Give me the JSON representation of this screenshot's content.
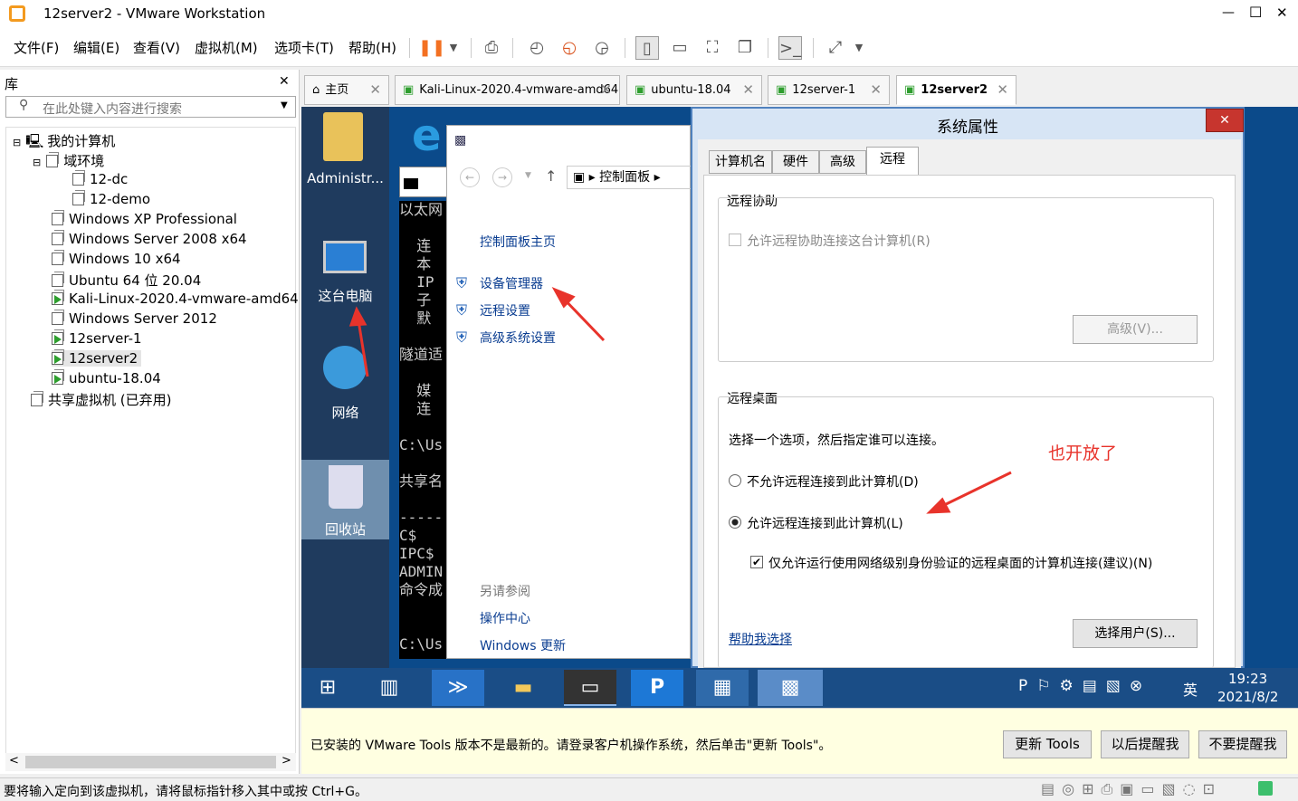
{
  "window": {
    "title": "12server2 - VMware Workstation",
    "minimize": "—",
    "maximize": "☐",
    "close": "✕"
  },
  "menu": [
    "文件(F)",
    "编辑(E)",
    "查看(V)",
    "虚拟机(M)",
    "选项卡(T)",
    "帮助(H)"
  ],
  "library": {
    "title": "库",
    "close": "✕",
    "search_placeholder": "在此处键入内容进行搜索",
    "root": "我的计算机",
    "domain_group": "域环境",
    "domain_items": [
      "12-dc",
      "12-demo"
    ],
    "vms": [
      "Windows XP Professional",
      "Windows Server 2008 x64",
      "Windows 10 x64",
      "Ubuntu 64 位 20.04",
      "Kali-Linux-2020.4-vmware-amd64",
      "Windows Server 2012",
      "12server-1",
      "12server2",
      "ubuntu-18.04"
    ],
    "shared": "共享虚拟机 (已弃用)"
  },
  "tabs": [
    {
      "label": "主页"
    },
    {
      "label": "Kali-Linux-2020.4-vmware-amd64"
    },
    {
      "label": "ubuntu-18.04"
    },
    {
      "label": "12server-1"
    },
    {
      "label": "12server2"
    }
  ],
  "tab_close": "✕",
  "guest": {
    "desktop": {
      "admin": "Administr...",
      "pc": "这台电脑",
      "net": "网络",
      "recycle": "回收站"
    },
    "cmd_lines": "以太网\n\n  连\n  本\n  IP\n  子\n  默\n\n隧道适\n\n  媒\n  连\n\nC:\\Us\n\n共享名\n\n-----\nC$\nIPC$\nADMIN\n命令成\n\n\nC:\\Us",
    "cp": {
      "breadcrumb": "控制面板",
      "home": "控制面板主页",
      "links": [
        "设备管理器",
        "远程设置",
        "高级系统设置"
      ],
      "see_also": "另请参阅",
      "also_links": [
        "操作中心",
        "Windows 更新"
      ]
    },
    "sysprops": {
      "title": "系统属性",
      "close": "✕",
      "tabs": [
        "计算机名",
        "硬件",
        "高级",
        "远程"
      ],
      "ra_group": "远程协助",
      "ra_check": "允许远程协助连接这台计算机(R)",
      "ra_adv": "高级(V)...",
      "rd_group": "远程桌面",
      "rd_desc": "选择一个选项，然后指定谁可以连接。",
      "rd_opt1": "不允许远程连接到此计算机(D)",
      "rd_opt2": "允许远程连接到此计算机(L)",
      "rd_nla": "仅允许运行使用网络级别身份验证的远程桌面的计算机连接(建议)(N)",
      "help_link": "帮助我选择",
      "select_users": "选择用户(S)..."
    },
    "annotation": "也开放了",
    "taskbar": {
      "time": "19:23",
      "date": "2021/8/2",
      "ime": "英"
    }
  },
  "notice": {
    "text": "已安装的 VMware Tools 版本不是最新的。请登录客户机操作系统，然后单击\"更新 Tools\"。",
    "update": "更新 Tools",
    "later": "以后提醒我",
    "never": "不要提醒我"
  },
  "status": "要将输入定向到该虚拟机，请将鼠标指针移入其中或按 Ctrl+G。",
  "colors": {
    "accent": "#0b4a8a",
    "link": "#0a3d91",
    "annotation": "#e8332b"
  }
}
